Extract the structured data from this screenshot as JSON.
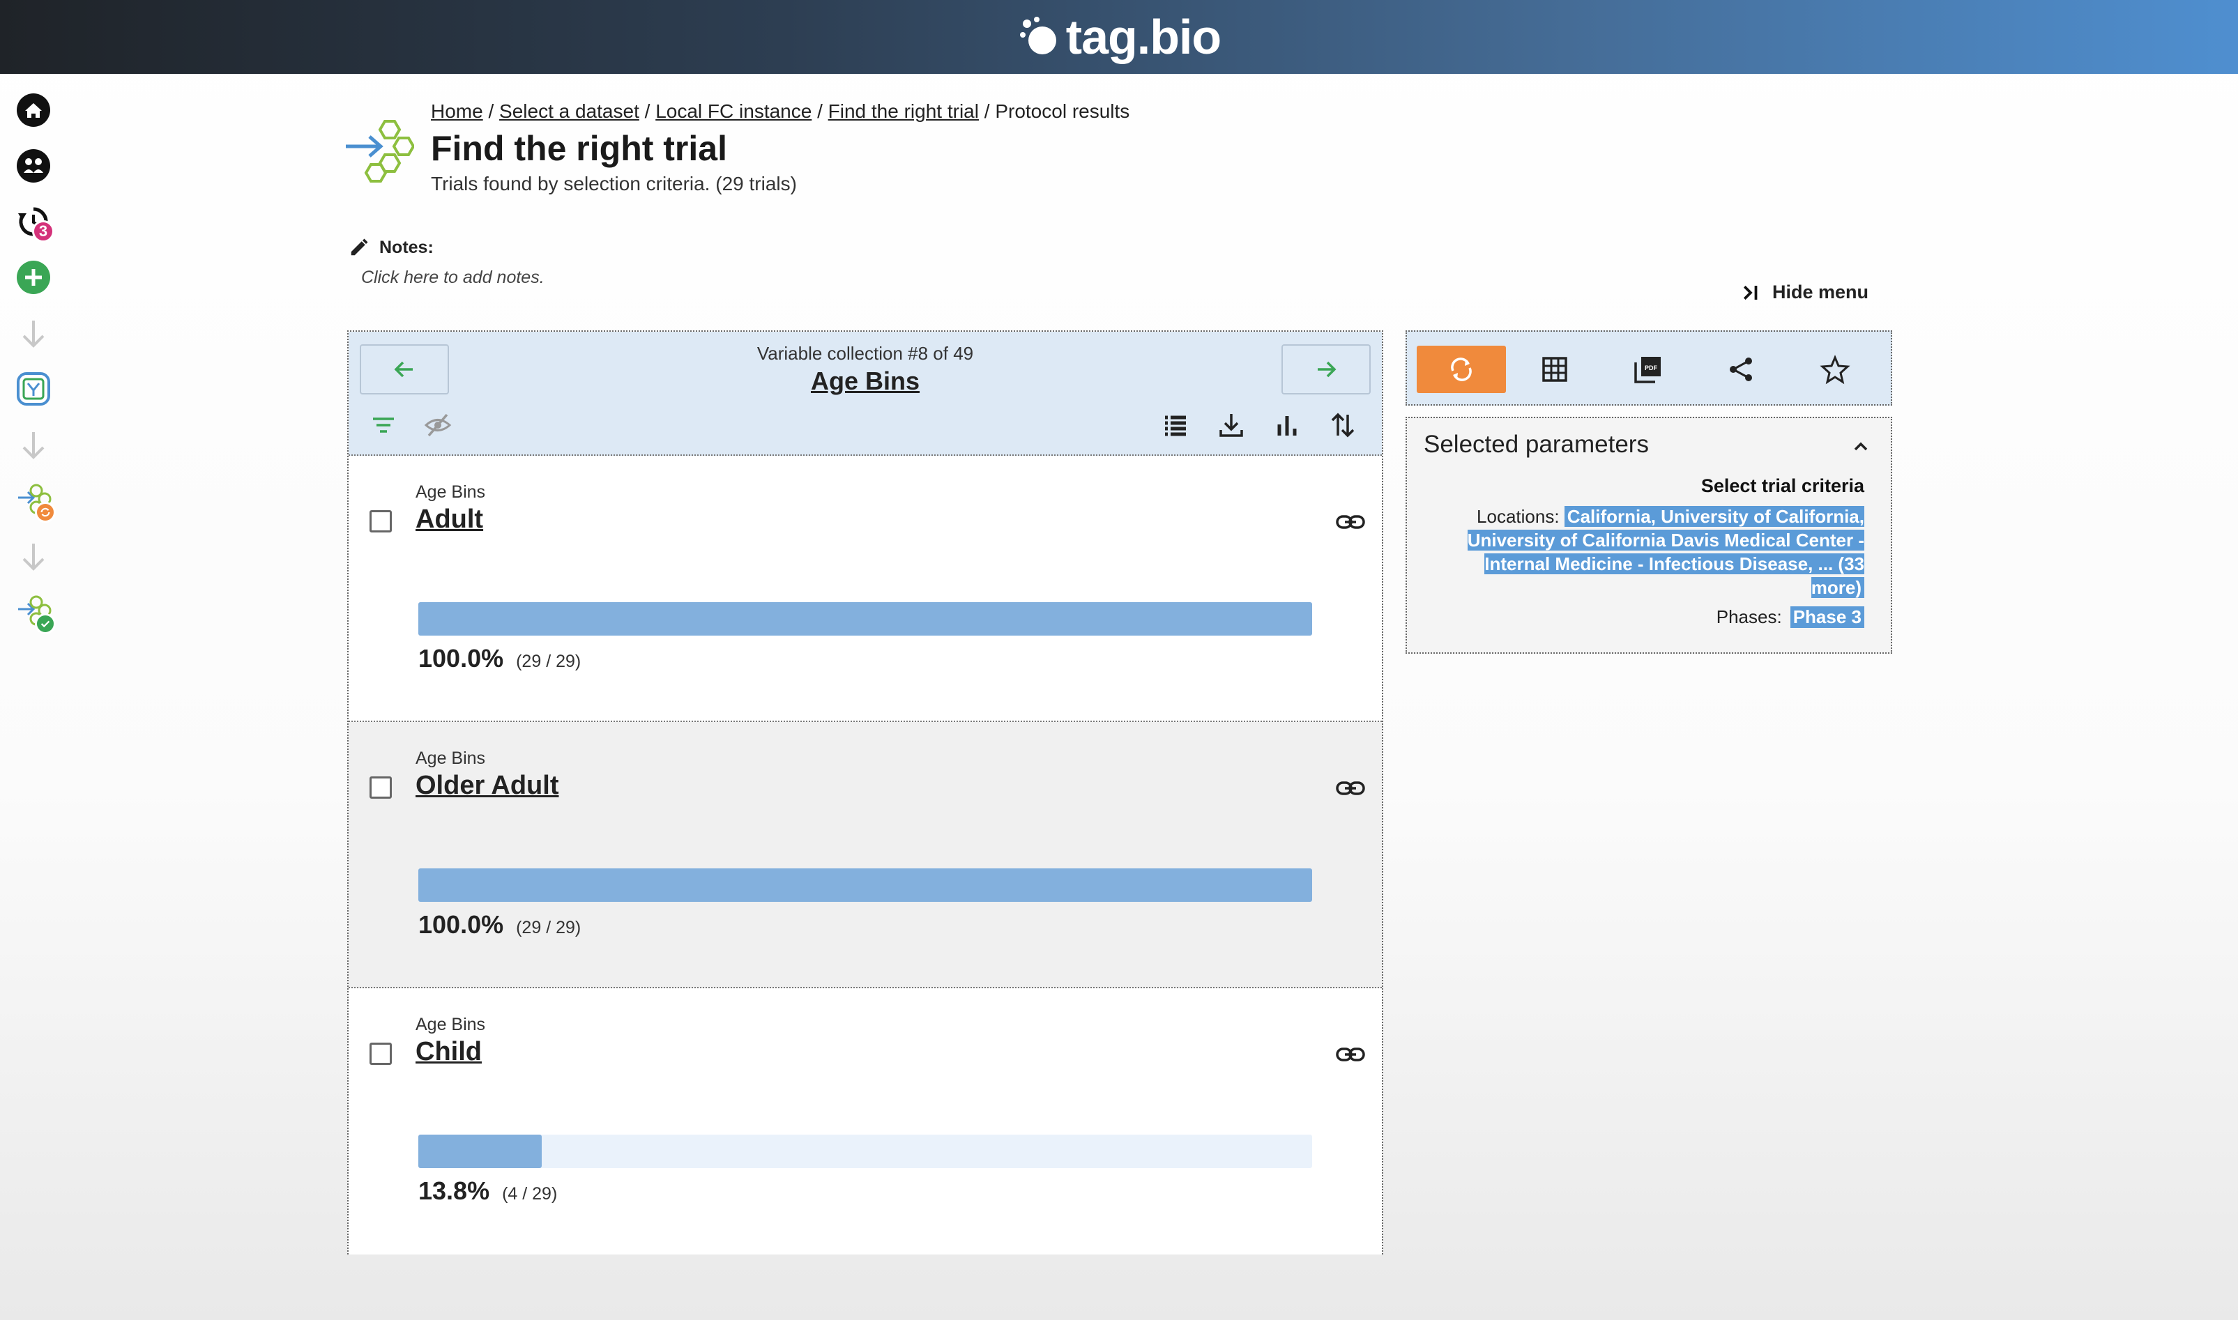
{
  "brand": {
    "name": "tag.bio"
  },
  "rail": {
    "history_badge": "3"
  },
  "breadcrumb": {
    "items": [
      "Home",
      "Select a dataset",
      "Local FC instance",
      "Find the right trial"
    ],
    "current": "Protocol results",
    "separator": " / "
  },
  "header": {
    "title": "Find the right trial",
    "subtitle": "Trials found by selection criteria. (29 trials)"
  },
  "notes": {
    "label": "Notes:",
    "placeholder": "Click here to add notes."
  },
  "hide_menu": {
    "label": "Hide menu"
  },
  "collection": {
    "counter": "Variable collection #8 of 49",
    "title": "Age Bins"
  },
  "rows": [
    {
      "category": "Age Bins",
      "name": "Adult",
      "percent": "100.0%",
      "count": "(29 / 29)",
      "fraction": 1.0
    },
    {
      "category": "Age Bins",
      "name": "Older Adult",
      "percent": "100.0%",
      "count": "(29 / 29)",
      "fraction": 1.0
    },
    {
      "category": "Age Bins",
      "name": "Child",
      "percent": "13.8%",
      "count": "(4 / 29)",
      "fraction": 0.138
    }
  ],
  "params": {
    "title": "Selected parameters",
    "criteria_heading": "Select trial criteria",
    "locations_label": "Locations:",
    "locations_value": "California, University of California, University of California Davis Medical Center - Internal Medicine - Infectious Disease, ... (33 more)",
    "phases_label": "Phases:",
    "phases_value": "Phase 3"
  },
  "colors": {
    "accent_orange": "#f08a3c",
    "bar_fill": "#83b0dd",
    "bar_track": "#eaf2fb",
    "panel_header": "#dde9f5",
    "highlight": "#5b9bd8",
    "badge": "#d4327a",
    "green": "#3aa655"
  },
  "icons": {
    "rail": [
      "home-icon",
      "community-icon",
      "history-icon",
      "add-icon",
      "arrow-down-icon",
      "dataset-icon",
      "arrow-down-icon",
      "protocol-icon",
      "arrow-down-icon",
      "protocol-complete-icon"
    ],
    "toolbar": [
      "filter-icon",
      "hide-icon",
      "list-icon",
      "download-icon",
      "bar-chart-icon",
      "sort-icon"
    ],
    "actions": [
      "refresh-icon",
      "table-icon",
      "pdf-icon",
      "share-icon",
      "star-icon"
    ]
  }
}
